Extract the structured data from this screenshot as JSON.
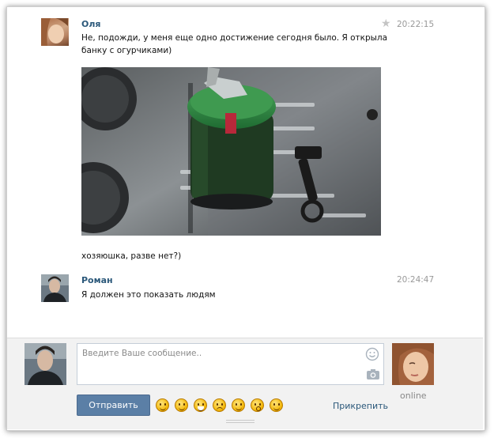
{
  "messages": [
    {
      "author": "Оля",
      "time": "20:22:15",
      "text_line1": "Не, подожди, у меня еще одно достижение сегодня было. Я открыла",
      "text_line2": "банку с огурчиками)",
      "caption": "хозяюшка, разве нет?)"
    },
    {
      "author": "Роман",
      "time": "20:24:47",
      "text": "Я должен это показать людям"
    }
  ],
  "composer": {
    "placeholder": "Введите Ваше сообщение..",
    "send_label": "Отправить",
    "attach_label": "Прикрепить",
    "status": "online"
  },
  "icons": [
    "star-icon",
    "smiley-icon",
    "camera-icon"
  ],
  "colors": {
    "name_link": "#2b587a",
    "send_button": "#5b7fa6",
    "composer_bg": "#f2f2f2"
  }
}
